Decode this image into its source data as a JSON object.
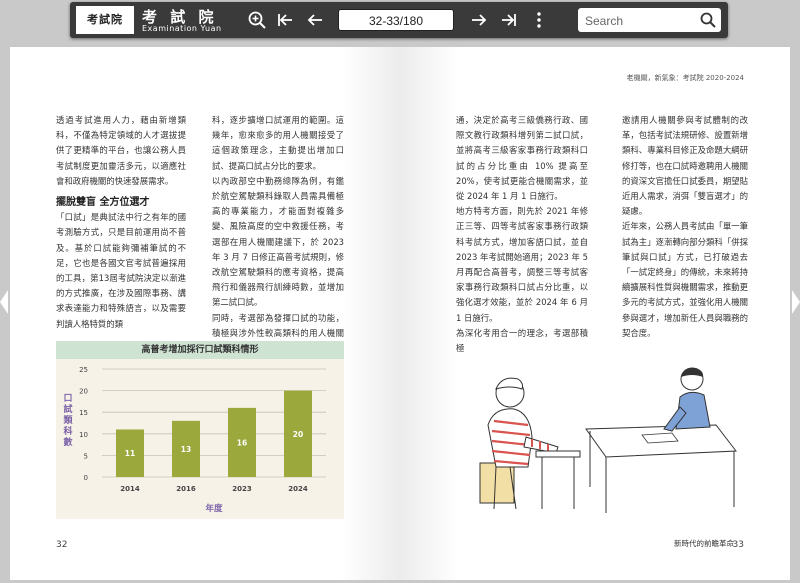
{
  "toolbar": {
    "logo_text": "考試院",
    "brand_zh": "考 試 院",
    "brand_en": "Examination Yuan",
    "page_indicator": "32-33/180",
    "search_placeholder": "Search",
    "icons": [
      "zoom-in-icon",
      "first-page-icon",
      "prev-page-icon",
      "next-page-icon",
      "last-page-icon",
      "more-icon",
      "search-icon"
    ]
  },
  "left_page": {
    "col1_p1": "透過考試進用人力，藉由新增類科，不僅為特定領域的人才選拔提供了更精準的平台，也讓公務人員考試制度更加靈活多元，以適應社會和政府機關的快速發展需求。",
    "col1_heading": "擺脫雙盲 全方位選才",
    "col1_p2": "「口試」是典試法中行之有年的國考測驗方式，只是目前運用尚不普及。基於口試能夠彌補筆試的不足，它也是各國文官考試普遍採用的工具，第13屆考試院決定以漸進的方式推廣，在涉及國際事務、講求表達能力和特殊語言，以及需要判讀人格特質的類",
    "col2_p1": "科，逐步擴增口試運用的範圍。這幾年，愈來愈多的用人機關接受了這個政策理念，主動提出增加口試、提高口試占分比的要求。",
    "col2_p2": "以內政部空中勤務總隊為例，有鑑於航空駕駛類科錄取人員需具備極高的專業能力，才能面對複雜多變、風險高度的空中救援任務，考選部在用人機關建議下，於 2023 年 3 月 7 日修正高普考試規則，修改航空駕駛類科的應考資格，提高飛行和儀器飛行訓練時數，並增加第二試口試。",
    "col2_p3": "同時，考選部為發揮口試的功能，積極與涉外性較高類科的用人機關溝",
    "page_number": "32"
  },
  "chart_data": {
    "type": "bar",
    "title": "高普考增加採行口試類科情形",
    "categories": [
      "2014",
      "2016",
      "2023",
      "2024"
    ],
    "values": [
      11,
      13,
      16,
      20
    ],
    "xlabel": "年度",
    "ylabel": "口試類科數",
    "ylim": [
      0,
      25
    ],
    "yticks": [
      0,
      5,
      10,
      15,
      20,
      25
    ],
    "grid": true,
    "bar_color": "#9aa83c",
    "background": "#f7f2e8",
    "title_bg": "#cfe3d3",
    "axis_label_color": "#7b63a8"
  },
  "right_page": {
    "running_head": "老機關，新氣象：考試院 2020-2024",
    "col1_p1": "通，決定於高考三級僑務行政、國際文教行政類科增列第二試口試，並將高考三級客家事務行政類科口試的占分比重由 10% 提高至 20%，使考試更能合機關需求，並從 2024 年 1 月 1 日施行。",
    "col1_p2": "地方特考方面，則先於 2021 年修正三等、四等考試客家事務行政類科考試方式，增加客語口試，並自 2023 年考試開始適用；2023 年 5 月再配合高普考，調整三等考試客家事務行政類科口試占分比重，以強化選才效能，並於 2024 年 6 月 1 日施行。",
    "col1_p3": "為深化考用合一的理念，考選部積極",
    "col2_p1": "邀請用人機關參與考試體制的改革，包括考試法規研修、設置新增類科、專業科目修正及命題大綱研修打等，也在口試時邀聘用人機關的資深文官擔任口試委員，期望貼近用人需求，消弭「雙盲選才」的疑慮。",
    "col2_p2": "近年來，公務人員考試由「單一筆試為主」逐漸轉向部分類科「併採筆試與口試」方式，已打破過去「一試定終身」的傳統，未來將持續擴展科性質與機關需求，推動更多元的考試方式，並強化用人機關參與選才，增加新任人員與職務的契合度。",
    "footer_title": "新時代的前瞻革命",
    "page_number": "33"
  }
}
